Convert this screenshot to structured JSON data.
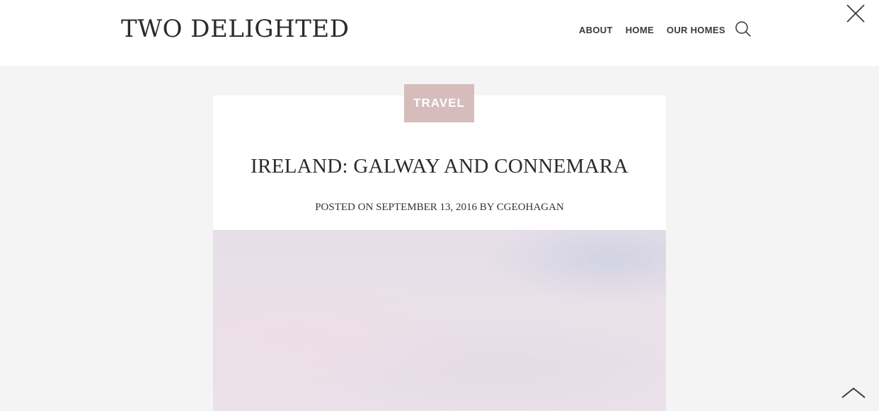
{
  "site": {
    "title": "TWO DELIGHTED"
  },
  "nav": {
    "items": [
      {
        "label": "ABOUT"
      },
      {
        "label": "HOME"
      },
      {
        "label": "OUR HOMES"
      }
    ]
  },
  "icons": {
    "search": "search-icon",
    "close": "close-icon",
    "back_to_top": "chevron-up-icon"
  },
  "post": {
    "category": "TRAVEL",
    "title": "IRELAND: GALWAY AND CONNEMARA",
    "meta": {
      "posted_on_label": "POSTED ON",
      "date": "SEPTEMBER 13, 2016",
      "by_label": "BY",
      "author": "CGEOHAGAN"
    }
  },
  "colors": {
    "page_background": "#f4f4f4",
    "header_background": "#ffffff",
    "badge_background": "#d7bcbc",
    "text": "#2b2b2b"
  }
}
